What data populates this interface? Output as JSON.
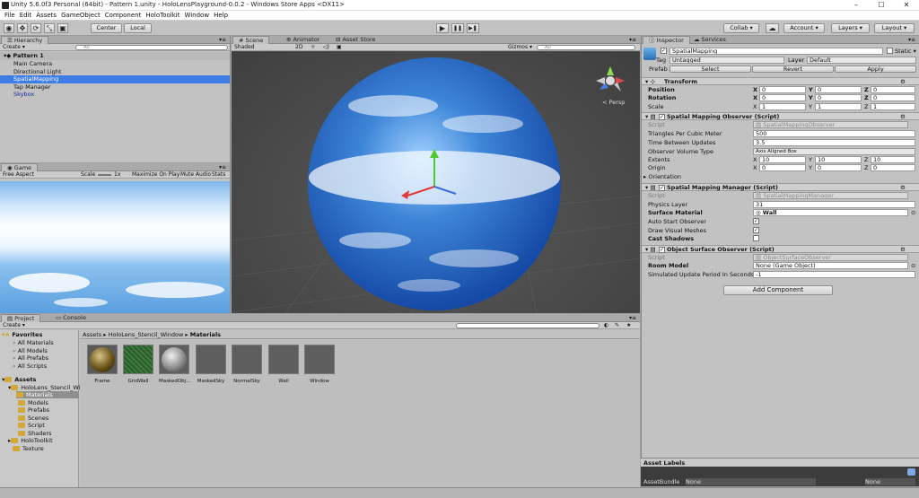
{
  "window": {
    "title": "Unity 5.6.0f3 Personal (64bit) - Pattern 1.unity - HoloLensPlayground-0.0.2 - Windows Store Apps <DX11>",
    "minimize": "–",
    "maximize": "☐",
    "close": "✕"
  },
  "menu": [
    "File",
    "Edit",
    "Assets",
    "GameObject",
    "Component",
    "HoloToolkit",
    "Window",
    "Help"
  ],
  "toolbar": {
    "center": "Center",
    "local": "Local",
    "play": "▶",
    "pause": "❚❚",
    "step": "▶❚",
    "collab": "Collab ▾",
    "account": "Account ▾",
    "layers": "Layers ▾",
    "layout": "Layout ▾"
  },
  "hierarchy": {
    "tab": "Hierarchy",
    "create": "Create ▾",
    "search": "All",
    "scene": "Pattern 1",
    "items": [
      {
        "label": "Main Camera",
        "selected": false,
        "blue": false
      },
      {
        "label": "Directional Light",
        "selected": false,
        "blue": false
      },
      {
        "label": "SpatialMapping",
        "selected": true,
        "blue": false
      },
      {
        "label": "Tap Manager",
        "selected": false,
        "blue": false
      },
      {
        "label": "Skybox",
        "selected": false,
        "blue": true
      }
    ]
  },
  "scene_tabs": {
    "scene": "Scene",
    "animator": "Animator",
    "asset_store": "Asset Store",
    "shaded": "Shaded",
    "mode2d": "2D",
    "gizmos": "Gizmos ▾",
    "search": "All",
    "persp": "< Persp"
  },
  "game": {
    "tab": "Game",
    "aspect": "Free Aspect",
    "scale_label": "Scale",
    "scale_value": "1x",
    "maximize": "Maximize On Play",
    "mute": "Mute Audio",
    "stats": "Stats"
  },
  "project": {
    "tab_project": "Project",
    "tab_console": "Console",
    "create": "Create ▾",
    "favorites": "Favorites",
    "fav_items": [
      "All Materials",
      "All Models",
      "All Prefabs",
      "All Scripts"
    ],
    "assets": "Assets",
    "stencil": "HoloLens_Stencil_Wi",
    "tree": [
      "Materials",
      "Models",
      "Prefabs",
      "Scenes",
      "Script",
      "Shaders"
    ],
    "holotoolkit": "HoloToolkit",
    "texture": "Texture",
    "breadcrumb": [
      "Assets",
      "HoloLens_Stencil_Window",
      "Materials"
    ],
    "materials": [
      {
        "name": "Frame",
        "kind": "gold"
      },
      {
        "name": "GridWall",
        "kind": "grid"
      },
      {
        "name": "MaskedObj...",
        "kind": "sphere"
      },
      {
        "name": "MaskedSky",
        "kind": "flat"
      },
      {
        "name": "NormalSky",
        "kind": "flat"
      },
      {
        "name": "Wall",
        "kind": "flat"
      },
      {
        "name": "Window",
        "kind": "flat"
      }
    ]
  },
  "inspector": {
    "tab": "Inspector",
    "services": "Services",
    "object_name": "SpatialMapping",
    "static": "Static ▾",
    "tag_label": "Tag",
    "tag_value": "Untagged",
    "layer_label": "Layer",
    "layer_value": "Default",
    "prefab_label": "Prefab",
    "select": "Select",
    "revert": "Revert",
    "apply": "Apply",
    "transform": {
      "title": "Transform",
      "position": "Position",
      "rotation": "Rotation",
      "scale": "Scale",
      "pos": [
        "0",
        "0",
        "0"
      ],
      "rot": [
        "0",
        "0",
        "0"
      ],
      "scl": [
        "1",
        "1",
        "1"
      ],
      "x": "X",
      "y": "Y",
      "z": "Z"
    },
    "observer": {
      "title": "Spatial Mapping Observer (Script)",
      "script_label": "Script",
      "script_value": "SpatialMappingObserver",
      "triangles_label": "Triangles Per Cubic Meter",
      "triangles_value": "500",
      "time_label": "Time Between Updates",
      "time_value": "3.5",
      "volume_label": "Observer Volume Type",
      "volume_value": "Axis Aligned Box",
      "extents_label": "Extents",
      "extents": [
        "10",
        "10",
        "10"
      ],
      "origin_label": "Origin",
      "origin": [
        "0",
        "0",
        "0"
      ],
      "orientation": "Orientation"
    },
    "manager": {
      "title": "Spatial Mapping Manager (Script)",
      "script_value": "SpatialMappingManager",
      "physics_label": "Physics Layer",
      "physics_value": "31",
      "surface_label": "Surface Material",
      "surface_value": "Wall",
      "auto_label": "Auto Start Observer",
      "draw_label": "Draw Visual Meshes",
      "cast_label": "Cast Shadows",
      "auto_checked": true,
      "draw_checked": true,
      "cast_checked": false
    },
    "surface_observer": {
      "title": "Object Surface Observer (Script)",
      "script_value": "ObjectSurfaceObserver",
      "room_label": "Room Model",
      "room_value": "None (Game Object)",
      "sim_label": "Simulated Update Period In Seconds",
      "sim_value": "-1"
    },
    "add_component": "Add Component",
    "asset_labels": "Asset Labels",
    "asset_bundle": "AssetBundle",
    "bundle_value": "None",
    "bundle_value2": "None"
  },
  "colors": {
    "selection": "#3e7de6",
    "panel": "#c2c2c2",
    "scene_bg": "#4a4a4a"
  }
}
